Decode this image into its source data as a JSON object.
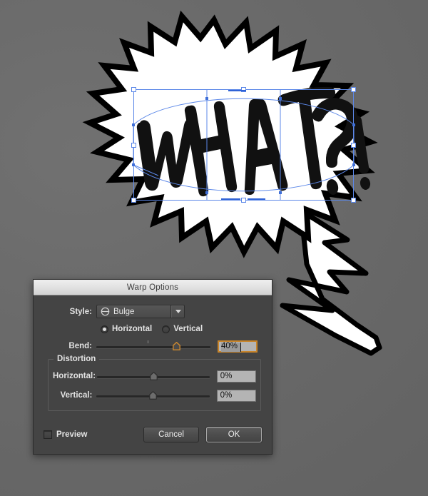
{
  "canvas": {
    "background_color": "#6b6b6b",
    "artwork": {
      "name": "comic-burst-speech-bubble",
      "word": "WHAT?!",
      "fill_color": "#ffffff",
      "stroke_color": "#000000"
    },
    "selection": {
      "name": "warp-envelope-selection",
      "color": "#4a7fe8",
      "handle_fill": "#ffffff"
    }
  },
  "dialog": {
    "title": "Warp Options",
    "style": {
      "label": "Style:",
      "value": "Bulge",
      "icon": "bulge-warp-icon"
    },
    "orientation": {
      "options": [
        {
          "label": "Horizontal",
          "selected": true
        },
        {
          "label": "Vertical",
          "selected": false
        }
      ]
    },
    "bend": {
      "label": "Bend:",
      "value": "40%",
      "slider_percent": 70,
      "focused": true,
      "accent_color": "#c8852b"
    },
    "distortion": {
      "legend": "Distortion",
      "horizontal": {
        "label": "Horizontal:",
        "value": "0%",
        "slider_percent": 50
      },
      "vertical": {
        "label": "Vertical:",
        "value": "0%",
        "slider_percent": 50
      }
    },
    "preview": {
      "label": "Preview",
      "checked": false
    },
    "buttons": {
      "cancel": "Cancel",
      "ok": "OK"
    }
  }
}
